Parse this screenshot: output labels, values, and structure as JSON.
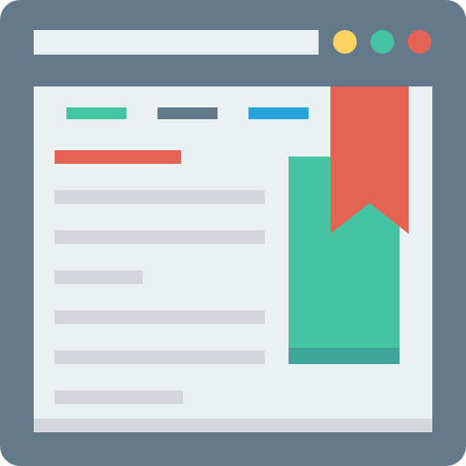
{
  "colors": {
    "frame": "#64798a",
    "address_bar": "#ebf0f3",
    "content_bg": "#ebf0f3",
    "content_footer": "#d5d6db",
    "traffic_yellow": "#fcd462",
    "traffic_green": "#44c4a1",
    "traffic_red": "#e56353",
    "tab_green": "#44c4a1",
    "tab_slate": "#64798a",
    "tab_blue": "#27a2db",
    "heading": "#e56353",
    "text_line": "#d5d6db",
    "book_cover": "#44c4a1",
    "book_bottom": "#3ea69b",
    "bookmark": "#e56353"
  },
  "icons": {
    "window": "browser-window-icon",
    "bookmark": "bookmark-ribbon-icon",
    "book": "book-icon"
  }
}
